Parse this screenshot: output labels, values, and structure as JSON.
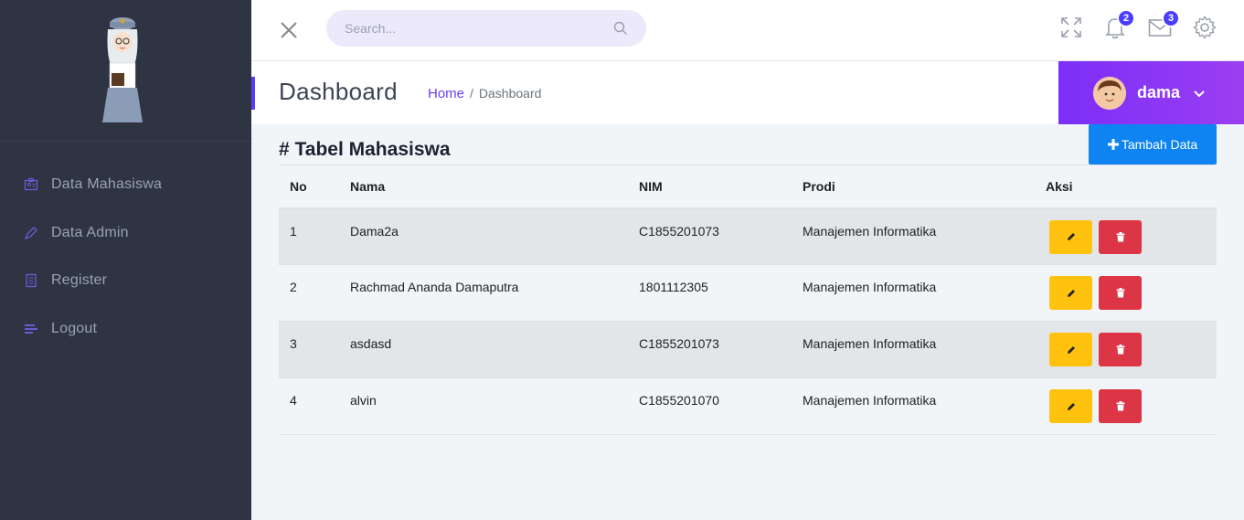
{
  "sidebar": {
    "items": [
      {
        "label": "Data Mahasiswa",
        "icon": "id-card-icon"
      },
      {
        "label": "Data Admin",
        "icon": "pen-icon"
      },
      {
        "label": "Register",
        "icon": "register-icon"
      },
      {
        "label": "Logout",
        "icon": "logout-icon"
      }
    ]
  },
  "topbar": {
    "search_placeholder": "Search...",
    "notifications_count": "2",
    "messages_count": "3"
  },
  "header": {
    "title": "Dashboard",
    "breadcrumb_home": "Home",
    "breadcrumb_sep": "/",
    "breadcrumb_current": "Dashboard",
    "user_name": "dama"
  },
  "main": {
    "section_title": "# Tabel Mahasiswa",
    "add_button_label": "Tambah Data",
    "columns": [
      "No",
      "Nama",
      "NIM",
      "Prodi",
      "Aksi"
    ],
    "rows": [
      {
        "no": "1",
        "nama": "Dama2a",
        "nim": "C1855201073",
        "prodi": "Manajemen Informatika"
      },
      {
        "no": "2",
        "nama": "Rachmad Ananda Damaputra",
        "nim": "1801112305",
        "prodi": "Manajemen Informatika"
      },
      {
        "no": "3",
        "nama": "asdasd",
        "nim": "C1855201073",
        "prodi": "Manajemen Informatika"
      },
      {
        "no": "4",
        "nama": "alvin",
        "nim": "C1855201070",
        "prodi": "Manajemen Informatika"
      }
    ]
  },
  "colors": {
    "sidebar_bg": "#2e3442",
    "accent": "#6a3df5",
    "primary_button": "#0d84f2",
    "edit_button": "#ffc20e",
    "delete_button": "#dc3545",
    "badge": "#4a3dff"
  }
}
